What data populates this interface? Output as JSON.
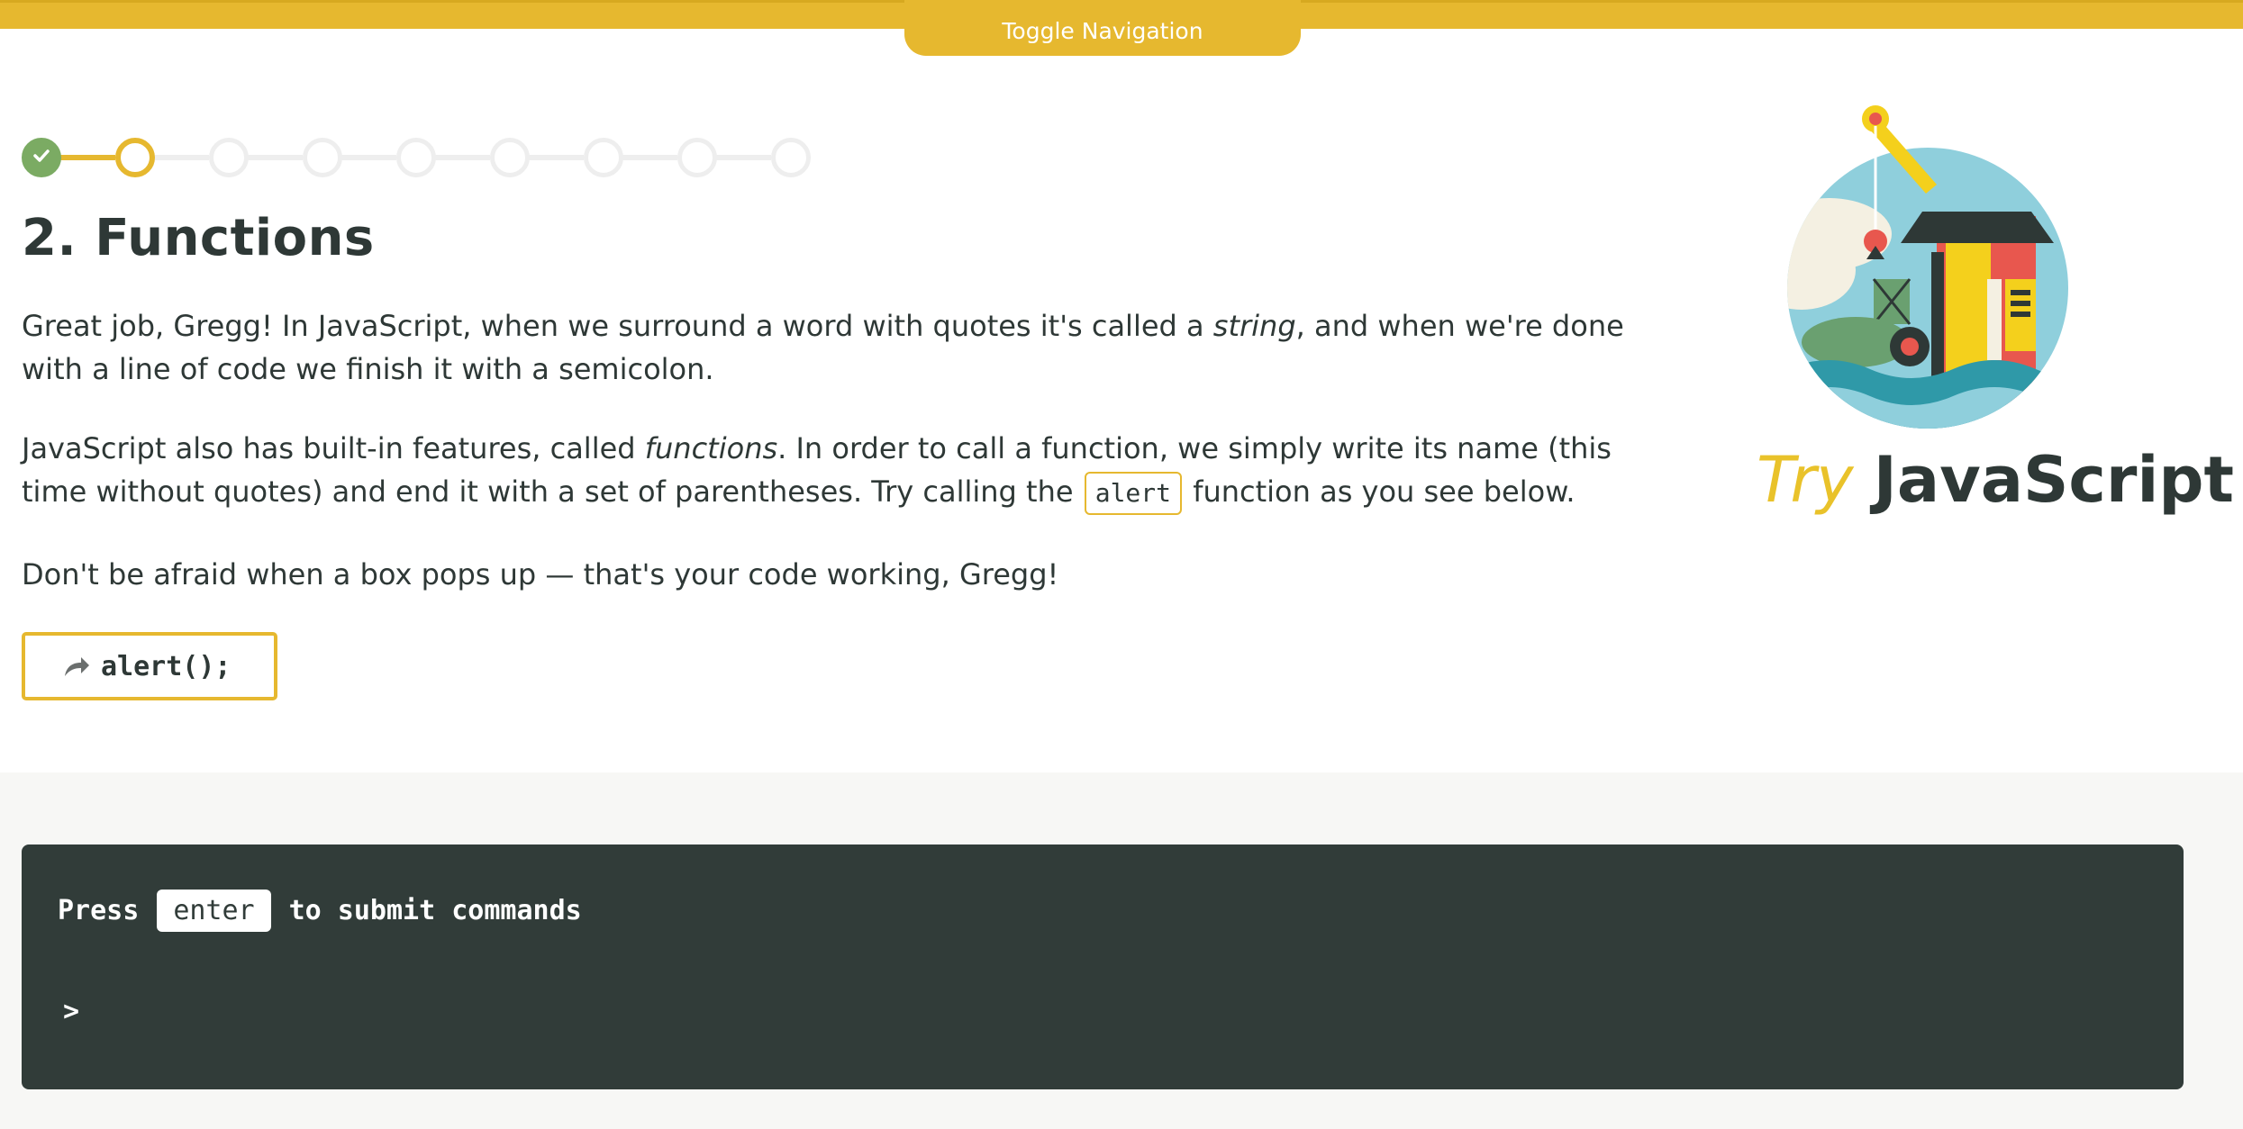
{
  "nav": {
    "toggle_label": "Toggle Navigation"
  },
  "progress": {
    "total_steps": 9,
    "current_step": 2,
    "completed_steps": 1
  },
  "lesson": {
    "title": "2. Functions",
    "p1": {
      "a": "Great job, Gregg! In JavaScript, when we surround a word with quotes it's called a ",
      "em": "string",
      "b": ", and when we're done with a line of code we finish it with a semicolon."
    },
    "p2": {
      "a": "JavaScript also has built-in features, called ",
      "em": "functions",
      "b": ". In order to call a function, we simply write its name (this time without quotes) and end it with a set of parentheses. Try calling the ",
      "code": "alert",
      "c": " function as you see below."
    },
    "p3": "Don't be afraid when a box pops up — that's your code working, Gregg!",
    "run_code": "alert();"
  },
  "logo": {
    "try": "Try",
    "name": "JavaScript"
  },
  "console": {
    "hint_before": "Press",
    "hint_key": "enter",
    "hint_after": "to submit commands",
    "prompt": ">",
    "input_value": ""
  },
  "colors": {
    "accent": "#e6b82f",
    "complete": "#7bab63",
    "console_bg": "#313c39",
    "text": "#2e3836"
  }
}
